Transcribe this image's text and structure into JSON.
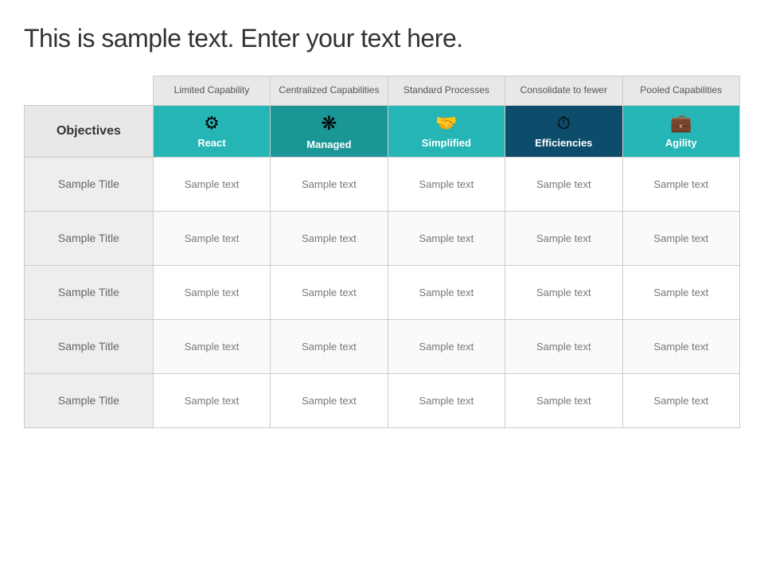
{
  "title": "This is sample text. Enter your text here.",
  "header": {
    "columns": [
      {
        "id": "limited",
        "label": "Limited Capability"
      },
      {
        "id": "centralized",
        "label": "Centralized Capabilities"
      },
      {
        "id": "standard",
        "label": "Standard Processes"
      },
      {
        "id": "consolidate",
        "label": "Consolidate to fewer"
      },
      {
        "id": "pooled",
        "label": "Pooled Capabilities"
      }
    ],
    "categories": [
      {
        "id": "objectives",
        "label": "Objectives",
        "icon": "",
        "bg": "objectives"
      },
      {
        "id": "react",
        "label": "React",
        "icon": "⚙",
        "bg": "react"
      },
      {
        "id": "managed",
        "label": "Managed",
        "icon": "✦",
        "bg": "managed"
      },
      {
        "id": "simplified",
        "label": "Simplified",
        "icon": "🤝",
        "bg": "simplified"
      },
      {
        "id": "efficiencies",
        "label": "Efficiencies",
        "icon": "⏱",
        "bg": "efficiencies"
      },
      {
        "id": "agility",
        "label": "Agility",
        "icon": "💼",
        "bg": "agility"
      }
    ]
  },
  "rows": [
    {
      "title": "Sample Title",
      "cells": [
        "Sample text",
        "Sample text",
        "Sample text",
        "Sample text",
        "Sample text"
      ]
    },
    {
      "title": "Sample Title",
      "cells": [
        "Sample text",
        "Sample text",
        "Sample text",
        "Sample text",
        "Sample text"
      ]
    },
    {
      "title": "Sample Title",
      "cells": [
        "Sample text",
        "Sample text",
        "Sample text",
        "Sample text",
        "Sample text"
      ]
    },
    {
      "title": "Sample Title",
      "cells": [
        "Sample text",
        "Sample text",
        "Sample text",
        "Sample text",
        "Sample text"
      ]
    },
    {
      "title": "Sample Title",
      "cells": [
        "Sample text",
        "Sample text",
        "Sample text",
        "Sample text",
        "Sample text"
      ]
    }
  ],
  "colors": {
    "react": "#26b5b5",
    "managed": "#1a9696",
    "simplified": "#26b5b5",
    "efficiencies": "#0d4d6b",
    "agility": "#26b5b5",
    "objectives_bg": "#e8e8e8",
    "header_bg": "#e8e8e8"
  },
  "icons": {
    "react": "⚙",
    "managed": "❋",
    "simplified": "🤝",
    "efficiencies": "⏱",
    "agility": "💼"
  }
}
